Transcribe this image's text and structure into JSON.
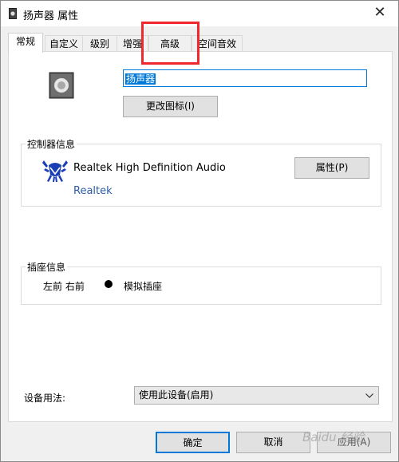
{
  "window": {
    "title": "扬声器 属性",
    "close_label": "✕"
  },
  "tabs": [
    "常规",
    "自定义",
    "级别",
    "增强",
    "高级",
    "空间音效"
  ],
  "general": {
    "name_value": "扬声器",
    "change_icon_label": "更改图标(I)"
  },
  "controller": {
    "group_label": "控制器信息",
    "device_name": "Realtek High Definition Audio",
    "vendor": "Realtek",
    "properties_label": "属性(P)"
  },
  "jack": {
    "group_label": "插座信息",
    "position": "左前 右前",
    "type": "模拟插座"
  },
  "usage": {
    "label": "设备用法:",
    "selected": "使用此设备(启用)"
  },
  "buttons": {
    "ok": "确定",
    "cancel": "取消",
    "apply": "应用(A)"
  },
  "watermark": "Baidu 经验",
  "colors": {
    "accent": "#0078d7",
    "highlight_box": "#f0282d",
    "vendor_link": "#2a5da8"
  }
}
